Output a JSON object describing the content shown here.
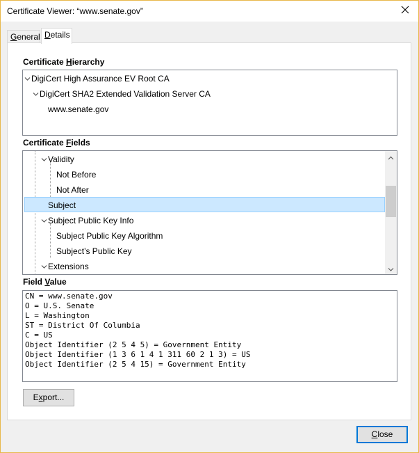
{
  "window": {
    "title": "Certificate Viewer: “www.senate.gov”"
  },
  "tabs": [
    {
      "label": "General",
      "mnemonic": "G",
      "rest": "eneral",
      "active": false
    },
    {
      "label": "Details",
      "mnemonic": "D",
      "rest": "etails",
      "active": true
    }
  ],
  "hierarchy": {
    "label_pre": "Certificate ",
    "label_mn": "H",
    "label_post": "ierarchy",
    "items": [
      {
        "label": "DigiCert High Assurance EV Root CA",
        "expanded": true
      },
      {
        "label": "DigiCert SHA2 Extended Validation Server CA",
        "expanded": true
      },
      {
        "label": "www.senate.gov",
        "expanded": false
      }
    ]
  },
  "fields": {
    "label_pre": "Certificate ",
    "label_mn": "F",
    "label_post": "ields",
    "items": [
      {
        "label": "Validity",
        "expanded": true
      },
      {
        "label": "Not Before"
      },
      {
        "label": "Not After"
      },
      {
        "label": "Subject",
        "selected": true
      },
      {
        "label": "Subject Public Key Info",
        "expanded": true
      },
      {
        "label": "Subject Public Key Algorithm"
      },
      {
        "label": "Subject’s Public Key"
      },
      {
        "label": "Extensions",
        "expanded": true
      }
    ]
  },
  "field_value": {
    "label_pre": "Field ",
    "label_mn": "V",
    "label_post": "alue",
    "lines": [
      "CN = www.senate.gov",
      "O = U.S. Senate",
      "L = Washington",
      "ST = District Of Columbia",
      "C = US",
      "Object Identifier (2 5 4 5) = Government Entity",
      "Object Identifier (1 3 6 1 4 1 311 60 2 1 3) = US",
      "Object Identifier (2 5 4 15) = Government Entity"
    ]
  },
  "buttons": {
    "export_mn": "x",
    "export_pre": "E",
    "export_post": "port...",
    "close_mn": "C",
    "close_post": "lose"
  },
  "colors": {
    "selection_bg": "#cce8ff",
    "selection_border": "#99d1ff",
    "default_button_border": "#0078d7"
  }
}
